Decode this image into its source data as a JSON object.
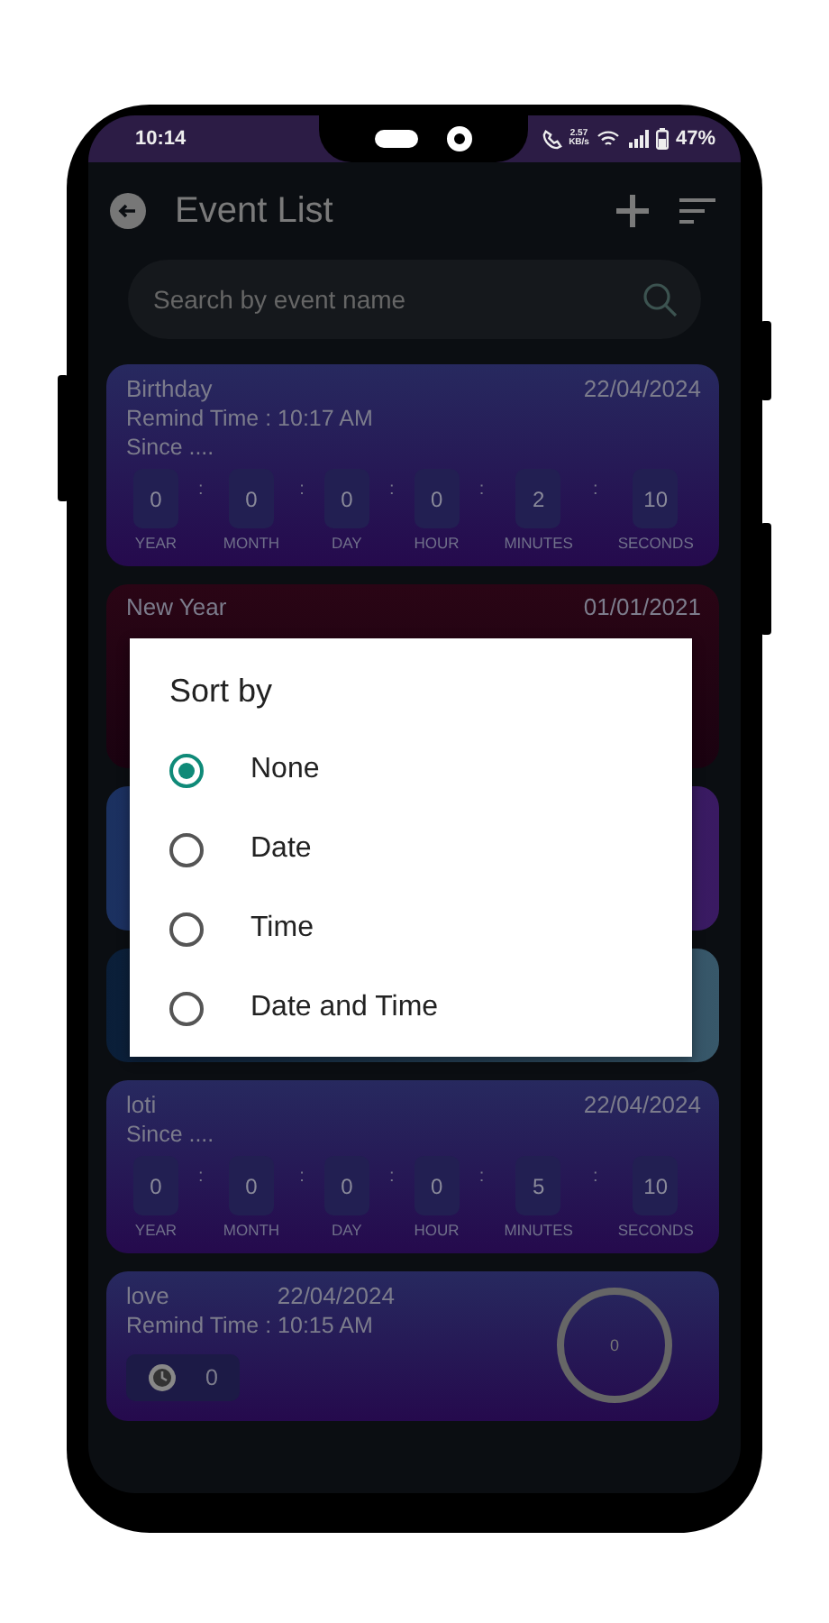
{
  "status_bar": {
    "time": "10:14",
    "speed_value": "2.57",
    "speed_unit": "KB/s",
    "battery": "47%"
  },
  "header": {
    "title": "Event List"
  },
  "search": {
    "placeholder": "Search by event name"
  },
  "events": [
    {
      "kind": "countdown",
      "title": "Birthday",
      "date": "22/04/2024",
      "remind": "Remind Time : 10:17 AM",
      "since": "Since ....",
      "separator": ":",
      "units": [
        {
          "value": "0",
          "label": "YEAR"
        },
        {
          "value": "0",
          "label": "MONTH"
        },
        {
          "value": "0",
          "label": "DAY"
        },
        {
          "value": "0",
          "label": "HOUR"
        },
        {
          "value": "2",
          "label": "MINUTES"
        },
        {
          "value": "10",
          "label": "SECONDS"
        }
      ]
    },
    {
      "kind": "covered",
      "title": "New Year",
      "date": "01/01/2021"
    },
    {
      "kind": "covered"
    },
    {
      "kind": "covered"
    },
    {
      "kind": "countdown",
      "title": "loti",
      "date": "22/04/2024",
      "since": "Since ....",
      "separator": ":",
      "units": [
        {
          "value": "0",
          "label": "YEAR"
        },
        {
          "value": "0",
          "label": "MONTH"
        },
        {
          "value": "0",
          "label": "DAY"
        },
        {
          "value": "0",
          "label": "HOUR"
        },
        {
          "value": "5",
          "label": "MINUTES"
        },
        {
          "value": "10",
          "label": "SECONDS"
        }
      ]
    },
    {
      "kind": "timer",
      "title": "love",
      "date": "22/04/2024",
      "remind": "Remind Time : 10:15 AM",
      "counter": "0",
      "ring": "0"
    }
  ],
  "dialog": {
    "title": "Sort by",
    "options": [
      {
        "label": "None",
        "selected": true
      },
      {
        "label": "Date",
        "selected": false
      },
      {
        "label": "Time",
        "selected": false
      },
      {
        "label": "Date and Time",
        "selected": false
      }
    ]
  }
}
